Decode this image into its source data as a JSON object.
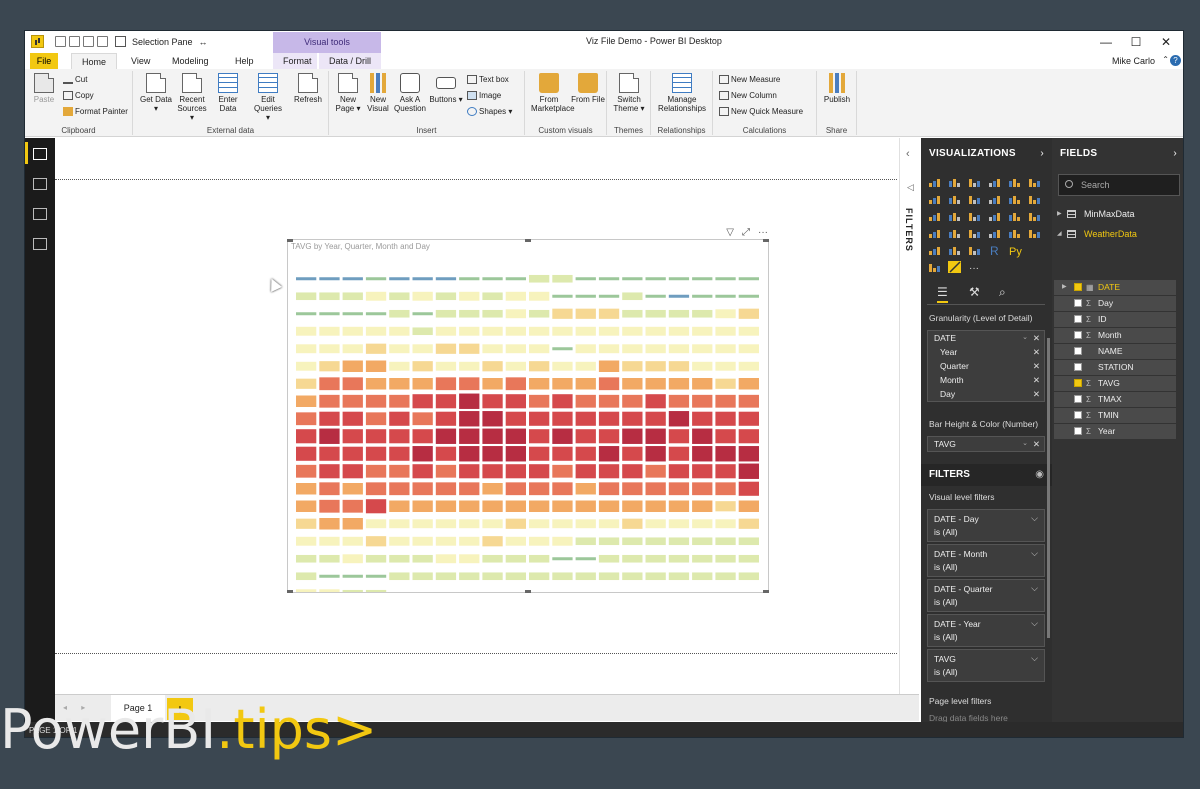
{
  "titlebar": {
    "title": "Viz File Demo - Power BI Desktop",
    "selection_pane_label": "Selection Pane",
    "visual_tools_label": "Visual tools",
    "minimize": "—",
    "maximize": "☐",
    "close": "✕"
  },
  "tabs": {
    "file": "File",
    "home": "Home",
    "view": "View",
    "modeling": "Modeling",
    "help": "Help",
    "format": "Format",
    "data_drill": "Data / Drill",
    "user": "Mike Carlo"
  },
  "ribbon": {
    "clipboard": {
      "paste": "Paste",
      "cut": "Cut",
      "copy": "Copy",
      "format_painter": "Format Painter",
      "label": "Clipboard"
    },
    "external": {
      "get_data": "Get Data ▾",
      "recent_sources": "Recent Sources ▾",
      "enter_data": "Enter Data",
      "edit_queries": "Edit Queries ▾",
      "refresh": "Refresh",
      "label": "External data"
    },
    "insert": {
      "new_page": "New Page ▾",
      "new_visual": "New Visual",
      "ask_question": "Ask A Question",
      "buttons": "Buttons ▾",
      "text_box": "Text box",
      "image": "Image",
      "shapes": "Shapes ▾",
      "label": "Insert"
    },
    "custom_visuals": {
      "from_marketplace": "From Marketplace",
      "from_file": "From File",
      "label": "Custom visuals"
    },
    "themes": {
      "switch_theme": "Switch Theme ▾",
      "label": "Themes"
    },
    "relationships": {
      "manage": "Manage Relationships",
      "label": "Relationships"
    },
    "calculations": {
      "new_measure": "New Measure",
      "new_column": "New Column",
      "new_quick_measure": "New Quick Measure",
      "label": "Calculations"
    },
    "share": {
      "publish": "Publish",
      "label": "Share"
    }
  },
  "visual": {
    "title": "TAVG by Year, Quarter, Month and Day",
    "filter_icon": "▽",
    "focus_icon": "⤢",
    "more_icon": "···"
  },
  "filters_strip": {
    "label": "FILTERS",
    "collapse": "‹",
    "expand": "◁"
  },
  "viz_pane": {
    "title": "VISUALIZATIONS",
    "chevron": "›",
    "fields_tab_icon": "fields-icon",
    "format_tab_icon": "paint-roller-icon",
    "analytics_tab_icon": "analytics-icon",
    "granularity_label": "Granularity (Level of Detail)",
    "granularity": {
      "field": "DATE",
      "children": [
        "Year",
        "Quarter",
        "Month",
        "Day"
      ]
    },
    "bar_height_label": "Bar Height & Color (Number)",
    "bar_height_field": "TAVG",
    "filters_title": "FILTERS",
    "visual_level_label": "Visual level filters",
    "filter_cards": [
      {
        "name": "DATE - Day",
        "state": "is (All)"
      },
      {
        "name": "DATE - Month",
        "state": "is (All)"
      },
      {
        "name": "DATE - Quarter",
        "state": "is (All)"
      },
      {
        "name": "DATE - Year",
        "state": "is (All)"
      },
      {
        "name": "TAVG",
        "state": "is (All)"
      }
    ],
    "page_level_label": "Page level filters",
    "page_level_hint": "Drag data fields here"
  },
  "fields_pane": {
    "title": "FIELDS",
    "chevron": "›",
    "search_placeholder": "Search",
    "tables": [
      "MinMaxData",
      "WeatherData"
    ],
    "fields": [
      {
        "name": "DATE",
        "checked": true,
        "type": "date"
      },
      {
        "name": "Day",
        "checked": false,
        "type": "sigma"
      },
      {
        "name": "ID",
        "checked": false,
        "type": "sigma"
      },
      {
        "name": "Month",
        "checked": false,
        "type": "sigma"
      },
      {
        "name": "NAME",
        "checked": false,
        "type": "text"
      },
      {
        "name": "STATION",
        "checked": false,
        "type": "text"
      },
      {
        "name": "TAVG",
        "checked": true,
        "type": "sigma"
      },
      {
        "name": "TMAX",
        "checked": false,
        "type": "sigma"
      },
      {
        "name": "TMIN",
        "checked": false,
        "type": "sigma"
      },
      {
        "name": "Year",
        "checked": false,
        "type": "sigma"
      }
    ]
  },
  "pagebar": {
    "page": "Page 1",
    "add": "+",
    "nav": "◂ ▸"
  },
  "status": {
    "text": "PAGE 1 OF 1"
  },
  "watermark": {
    "text": "PowerBI",
    "tips": ".tips>"
  },
  "colors": {
    "accent": "#f2c811",
    "heat_scale": [
      "#6f9dbf",
      "#9cc79a",
      "#dde9ad",
      "#f7f3bd",
      "#f6d893",
      "#f2a964",
      "#e8775a",
      "#d5494c",
      "#b72d42"
    ]
  },
  "heatmap": {
    "rows": [
      [
        0,
        0,
        0,
        1,
        0,
        0,
        0,
        1,
        1,
        1,
        2,
        2,
        1,
        1,
        1,
        1,
        1,
        1,
        1,
        1
      ],
      [
        2,
        2,
        2,
        3,
        2,
        3,
        2,
        3,
        2,
        3,
        3,
        1,
        1,
        1,
        2,
        1,
        0,
        1,
        1,
        1
      ],
      [
        1,
        1,
        1,
        1,
        2,
        1,
        2,
        2,
        2,
        3,
        2,
        4,
        4,
        4,
        2,
        2,
        2,
        2,
        3,
        4
      ],
      [
        3,
        3,
        3,
        3,
        3,
        2,
        3,
        3,
        3,
        3,
        3,
        3,
        3,
        3,
        3,
        3,
        3,
        3,
        3,
        3
      ],
      [
        3,
        3,
        3,
        4,
        3,
        3,
        4,
        4,
        3,
        3,
        3,
        1,
        3,
        3,
        3,
        3,
        3,
        3,
        3,
        3
      ],
      [
        3,
        4,
        5,
        5,
        3,
        4,
        3,
        3,
        4,
        3,
        4,
        3,
        3,
        5,
        4,
        4,
        4,
        3,
        3,
        3
      ],
      [
        4,
        6,
        6,
        5,
        5,
        5,
        6,
        6,
        5,
        6,
        5,
        5,
        5,
        6,
        5,
        5,
        5,
        5,
        4,
        5
      ],
      [
        5,
        6,
        6,
        6,
        6,
        7,
        7,
        8,
        7,
        7,
        6,
        7,
        6,
        6,
        6,
        7,
        6,
        6,
        6,
        6
      ],
      [
        6,
        7,
        7,
        6,
        7,
        6,
        7,
        8,
        8,
        7,
        7,
        7,
        7,
        7,
        7,
        7,
        8,
        7,
        7,
        7
      ],
      [
        7,
        8,
        7,
        7,
        7,
        7,
        8,
        8,
        8,
        8,
        7,
        8,
        7,
        7,
        8,
        8,
        7,
        8,
        7,
        7
      ],
      [
        7,
        7,
        7,
        7,
        7,
        8,
        7,
        8,
        8,
        8,
        7,
        7,
        7,
        8,
        7,
        8,
        7,
        8,
        8,
        8
      ],
      [
        6,
        7,
        7,
        6,
        6,
        7,
        6,
        7,
        7,
        7,
        7,
        6,
        7,
        7,
        7,
        6,
        7,
        7,
        7,
        8
      ],
      [
        5,
        6,
        5,
        6,
        6,
        6,
        6,
        6,
        5,
        6,
        6,
        6,
        5,
        6,
        6,
        6,
        6,
        6,
        6,
        7
      ],
      [
        5,
        6,
        6,
        7,
        5,
        5,
        5,
        5,
        5,
        5,
        5,
        5,
        5,
        5,
        5,
        5,
        5,
        5,
        4,
        5
      ],
      [
        4,
        5,
        5,
        3,
        3,
        3,
        3,
        3,
        3,
        4,
        3,
        3,
        3,
        3,
        4,
        3,
        3,
        3,
        3,
        4
      ],
      [
        3,
        3,
        3,
        4,
        3,
        3,
        3,
        3,
        4,
        3,
        3,
        3,
        2,
        2,
        2,
        2,
        2,
        2,
        2,
        2
      ],
      [
        2,
        2,
        3,
        2,
        2,
        2,
        3,
        3,
        2,
        2,
        2,
        1,
        1,
        2,
        2,
        2,
        2,
        2,
        2,
        2
      ],
      [
        2,
        1,
        1,
        1,
        2,
        2,
        2,
        2,
        2,
        2,
        2,
        2,
        2,
        2,
        2,
        2,
        2,
        2,
        2,
        2
      ],
      [
        3,
        3,
        2,
        2,
        -1,
        -1,
        -1,
        -1,
        -1,
        -1,
        -1,
        -1,
        -1,
        -1,
        -1,
        -1,
        -1,
        -1,
        -1,
        -1
      ]
    ]
  }
}
